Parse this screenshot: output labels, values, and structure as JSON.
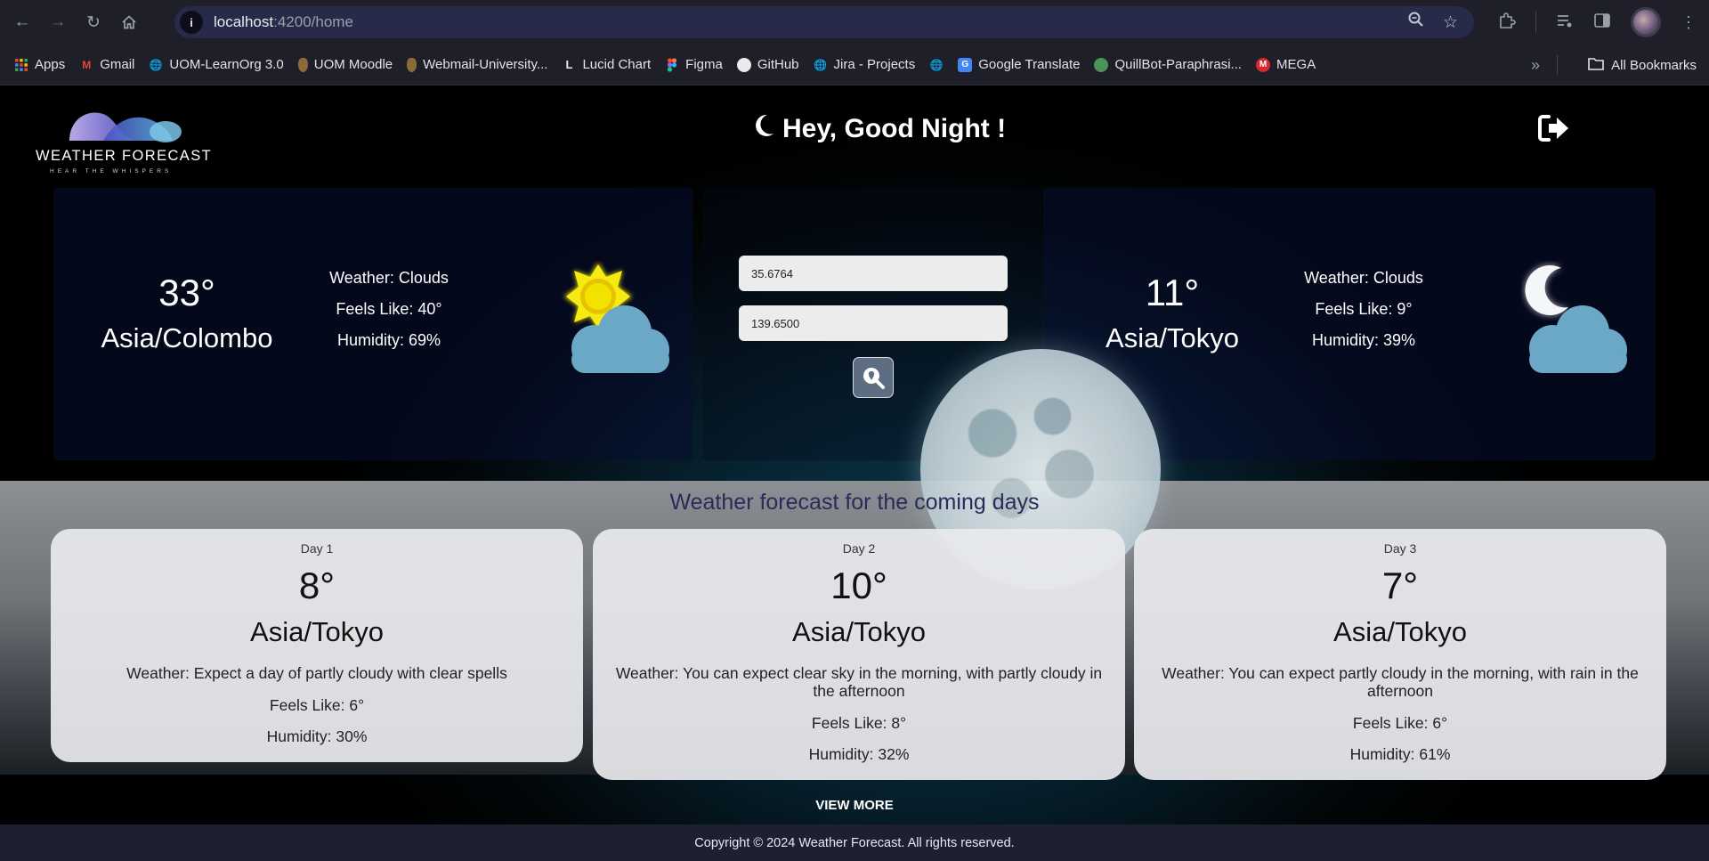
{
  "browser": {
    "url_host": "localhost",
    "url_path": ":4200/home",
    "bookmarks": [
      {
        "label": "Apps",
        "icon": "apps-grid-icon",
        "color": "#ea4335"
      },
      {
        "label": "Gmail",
        "icon": "gmail-icon",
        "color": "#ea4335"
      },
      {
        "label": "UOM-LearnOrg 3.0",
        "icon": "globe-icon",
        "color": "#9aa0a6"
      },
      {
        "label": "UOM Moodle",
        "icon": "uom-crest-icon",
        "color": "#8b6a3a"
      },
      {
        "label": "Webmail-University...",
        "icon": "uom-crest-icon",
        "color": "#8b6a3a"
      },
      {
        "label": "Lucid Chart",
        "icon": "lucid-icon",
        "color": "#e8eaed"
      },
      {
        "label": "Figma",
        "icon": "figma-icon",
        "color": "#f24e1e"
      },
      {
        "label": "GitHub",
        "icon": "github-icon",
        "color": "#e8eaed"
      },
      {
        "label": "Jira - Projects",
        "icon": "globe-icon",
        "color": "#9aa0a6"
      },
      {
        "label": "",
        "icon": "globe-icon",
        "color": "#9aa0a6"
      },
      {
        "label": "Google Translate",
        "icon": "translate-icon",
        "color": "#4285f4"
      },
      {
        "label": "QuillBot-Paraphrasi...",
        "icon": "quillbot-icon",
        "color": "#499557"
      },
      {
        "label": "MEGA",
        "icon": "mega-icon",
        "color": "#d9272e"
      }
    ],
    "all_bookmarks": "All Bookmarks"
  },
  "app": {
    "logo_text": "WEATHER FORECAST",
    "logo_tagline": "HEAR THE WHISPERS",
    "greeting": "Hey, Good Night !"
  },
  "current": {
    "left": {
      "temp": "33°",
      "city": "Asia/Colombo",
      "weather": "Weather: Clouds",
      "feels_like": "Feels Like: 40°",
      "humidity": "Humidity: 69%",
      "icon": "sun-cloud-icon"
    },
    "right": {
      "temp": "11°",
      "city": "Asia/Tokyo",
      "weather": "Weather: Clouds",
      "feels_like": "Feels Like: 9°",
      "humidity": "Humidity: 39%",
      "icon": "moon-cloud-icon"
    }
  },
  "search": {
    "latitude": "35.6764",
    "longitude": "139.6500"
  },
  "forecast": {
    "title": "Weather forecast for the coming days",
    "days": [
      {
        "day": "Day 1",
        "temp": "8°",
        "city": "Asia/Tokyo",
        "weather": "Weather: Expect a day of partly cloudy with clear spells",
        "feels_like": "Feels Like: 6°",
        "humidity": "Humidity: 30%"
      },
      {
        "day": "Day 2",
        "temp": "10°",
        "city": "Asia/Tokyo",
        "weather": "Weather: You can expect clear sky in the morning, with partly cloudy in the afternoon",
        "feels_like": "Feels Like: 8°",
        "humidity": "Humidity: 32%"
      },
      {
        "day": "Day 3",
        "temp": "7°",
        "city": "Asia/Tokyo",
        "weather": "Weather: You can expect partly cloudy in the morning, with rain in the afternoon",
        "feels_like": "Feels Like: 6°",
        "humidity": "Humidity: 61%"
      }
    ],
    "view_more": "VIEW MORE"
  },
  "footer": {
    "copyright": "Copyright © 2024 Weather Forecast. All rights reserved."
  }
}
